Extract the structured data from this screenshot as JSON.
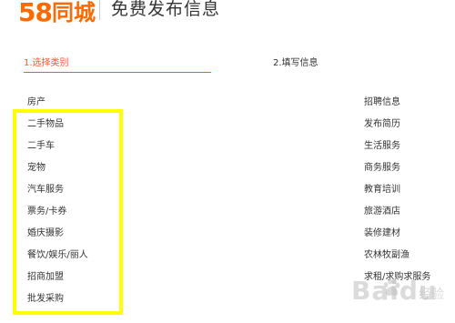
{
  "header": {
    "logo_number": "58",
    "logo_text": "同城",
    "title": "免费发布信息"
  },
  "steps": [
    {
      "label": "1.选择类别",
      "active": true
    },
    {
      "label": "2.填写信息",
      "active": false
    }
  ],
  "colors": {
    "accent": "#ff552e",
    "logo": "#ff6a00",
    "highlight": "#ffff00"
  },
  "categories_left": [
    "房产",
    "二手物品",
    "二手车",
    "宠物",
    "汽车服务",
    "票务/卡券",
    "婚庆摄影",
    "餐饮/娱乐/丽人",
    "招商加盟",
    "批发采购"
  ],
  "categories_right": [
    "招聘信息",
    "发布简历",
    "生活服务",
    "商务服务",
    "教育培训",
    "旅游酒店",
    "装修建材",
    "农林牧副渔",
    "求租/求购求服务"
  ],
  "watermark": {
    "text": "Baidu",
    "sub": "经验"
  }
}
